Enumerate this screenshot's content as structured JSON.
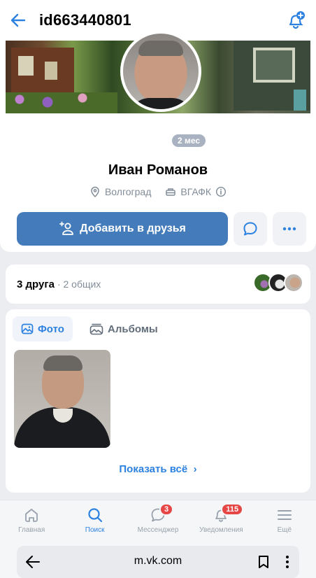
{
  "header": {
    "title": "id663440801",
    "back_icon": "arrow-left-icon",
    "notify_icon": "bell-plus-icon"
  },
  "profile": {
    "online_badge": "2 мес",
    "name": "Иван Романов",
    "city": "Волгоград",
    "university": "ВГАФК",
    "add_friend_label": "Добавить в друзья"
  },
  "friends": {
    "count_label": "3 друга",
    "common_label": "· 2 общих"
  },
  "photos": {
    "tab_photo": "Фото",
    "tab_albums": "Альбомы",
    "show_all": "Показать всё"
  },
  "nav": {
    "items": [
      {
        "label": "Главная",
        "icon": "home-icon"
      },
      {
        "label": "Поиск",
        "icon": "search-icon"
      },
      {
        "label": "Мессенджер",
        "icon": "chat-icon",
        "badge": "3"
      },
      {
        "label": "Уведомления",
        "icon": "bell-icon",
        "badge": "115"
      },
      {
        "label": "Ещё",
        "icon": "menu-icon"
      }
    ],
    "active": "Поиск"
  },
  "browser": {
    "url": "m.vk.com"
  },
  "colors": {
    "accent": "#447bba",
    "link": "#2d81e0",
    "badge": "#e64646",
    "muted": "#818c99"
  }
}
